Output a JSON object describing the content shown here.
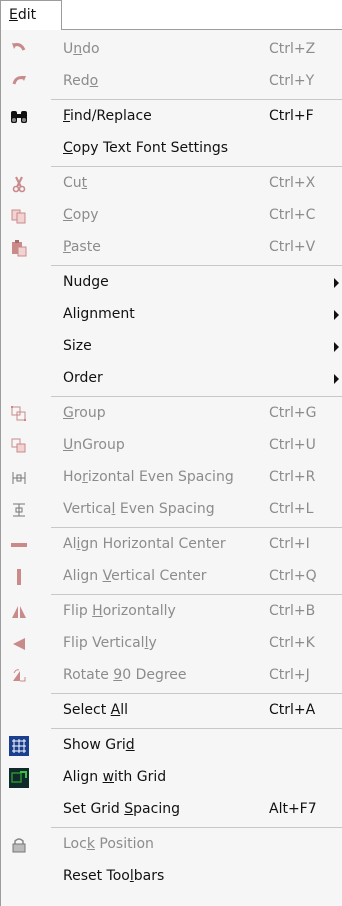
{
  "menubar": {
    "edit_label": "Edit"
  },
  "items": [
    {
      "id": "undo",
      "icon": "undo-icon",
      "label": "Undo",
      "u": 1,
      "shortcut": "Ctrl+Z",
      "disabled": true
    },
    {
      "id": "redo",
      "icon": "redo-icon",
      "label": "Redo",
      "u": 3,
      "shortcut": "Ctrl+Y",
      "disabled": true
    },
    {
      "sep": true
    },
    {
      "id": "find-replace",
      "icon": "binoculars-icon",
      "label": "Find/Replace",
      "u": 0,
      "shortcut": "Ctrl+F",
      "disabled": false
    },
    {
      "id": "copy-text-font-settings",
      "icon": "",
      "label": "Copy Text Font Settings",
      "u": 0,
      "shortcut": "",
      "disabled": false
    },
    {
      "sep": true
    },
    {
      "id": "cut",
      "icon": "scissors-icon",
      "label": "Cut",
      "u": 2,
      "shortcut": "Ctrl+X",
      "disabled": true
    },
    {
      "id": "copy",
      "icon": "copy-icon",
      "label": "Copy",
      "u": 0,
      "shortcut": "Ctrl+C",
      "disabled": true
    },
    {
      "id": "paste",
      "icon": "paste-icon",
      "label": "Paste",
      "u": 0,
      "shortcut": "Ctrl+V",
      "disabled": true
    },
    {
      "sep": true
    },
    {
      "id": "nudge",
      "icon": "",
      "label": "Nudge",
      "u": -1,
      "shortcut": "",
      "submenu": true,
      "disabled": false
    },
    {
      "id": "alignment",
      "icon": "",
      "label": "Alignment",
      "u": -1,
      "shortcut": "",
      "submenu": true,
      "disabled": false
    },
    {
      "id": "size",
      "icon": "",
      "label": "Size",
      "u": -1,
      "shortcut": "",
      "submenu": true,
      "disabled": false
    },
    {
      "id": "order",
      "icon": "",
      "label": "Order",
      "u": -1,
      "shortcut": "",
      "submenu": true,
      "disabled": false
    },
    {
      "sep": true
    },
    {
      "id": "group",
      "icon": "group-icon",
      "label": "Group",
      "u": 0,
      "shortcut": "Ctrl+G",
      "disabled": true
    },
    {
      "id": "ungroup",
      "icon": "ungroup-icon",
      "label": "UnGroup",
      "u": 0,
      "shortcut": "Ctrl+U",
      "disabled": true
    },
    {
      "id": "horizontal-even-spacing",
      "icon": "horizontal-spacing-icon",
      "label": "Horizontal Even Spacing",
      "u": 2,
      "shortcut": "Ctrl+R",
      "disabled": true
    },
    {
      "id": "vertical-even-spacing",
      "icon": "vertical-spacing-icon",
      "label": "Vertical Even Spacing",
      "u": 7,
      "shortcut": "Ctrl+L",
      "disabled": true
    },
    {
      "sep": true
    },
    {
      "id": "align-horizontal-center",
      "icon": "align-horizontal-center-icon",
      "label": "Align Horizontal Center",
      "u": 2,
      "shortcut": "Ctrl+I",
      "disabled": true
    },
    {
      "id": "align-vertical-center",
      "icon": "align-vertical-center-icon",
      "label": "Align Vertical Center",
      "u": 6,
      "shortcut": "Ctrl+Q",
      "disabled": true
    },
    {
      "sep": true
    },
    {
      "id": "flip-horizontally",
      "icon": "flip-horizontal-icon",
      "label": "Flip Horizontally",
      "u": 5,
      "shortcut": "Ctrl+B",
      "disabled": true
    },
    {
      "id": "flip-vertically",
      "icon": "flip-vertical-icon",
      "label": "Flip Vertically",
      "u": 13,
      "shortcut": "Ctrl+K",
      "disabled": true
    },
    {
      "id": "rotate-90-degree",
      "icon": "rotate-icon",
      "label": "Rotate 90 Degree",
      "u": 7,
      "shortcut": "Ctrl+J",
      "disabled": true
    },
    {
      "sep": true
    },
    {
      "id": "select-all",
      "icon": "",
      "label": "Select All",
      "u": 7,
      "shortcut": "Ctrl+A",
      "disabled": false
    },
    {
      "sep": true
    },
    {
      "id": "show-grid",
      "icon": "grid-icon",
      "label": "Show Grid",
      "u": 8,
      "shortcut": "",
      "disabled": false
    },
    {
      "id": "align-with-grid",
      "icon": "align-grid-icon",
      "label": "Align with Grid",
      "u": 6,
      "shortcut": "",
      "disabled": false
    },
    {
      "id": "set-grid-spacing",
      "icon": "",
      "label": "Set Grid Spacing",
      "u": 9,
      "shortcut": "Alt+F7",
      "disabled": false
    },
    {
      "sep": true
    },
    {
      "id": "lock-position",
      "icon": "lock-icon",
      "label": "Lock Position",
      "u": 3,
      "shortcut": "",
      "disabled": true
    },
    {
      "id": "reset-toolbars",
      "icon": "",
      "label": "Reset Toolbars",
      "u": 9,
      "shortcut": "",
      "disabled": false
    }
  ],
  "colors": {
    "disabled_text": "#8c8c8c",
    "disabled_icon": "#c98a8a",
    "grid_icon_blue": "#1a3f8f",
    "grid_icon_green": "#2f8f2f"
  }
}
